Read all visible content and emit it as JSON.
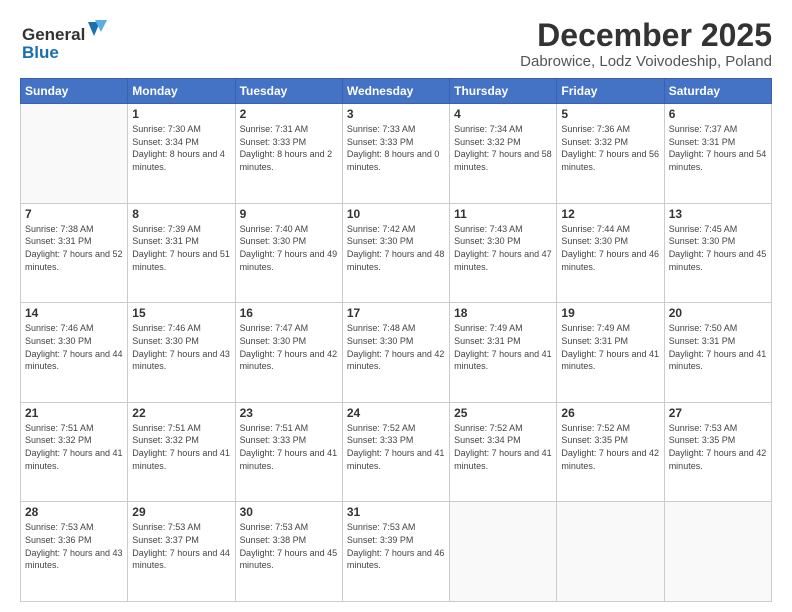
{
  "header": {
    "logo_line1": "General",
    "logo_line2": "Blue",
    "title": "December 2025",
    "subtitle": "Dabrowice, Lodz Voivodeship, Poland"
  },
  "weekdays": [
    "Sunday",
    "Monday",
    "Tuesday",
    "Wednesday",
    "Thursday",
    "Friday",
    "Saturday"
  ],
  "weeks": [
    [
      {
        "day": "",
        "sunrise": "",
        "sunset": "",
        "daylight": ""
      },
      {
        "day": "1",
        "sunrise": "7:30 AM",
        "sunset": "3:34 PM",
        "daylight": "8 hours and 4 minutes."
      },
      {
        "day": "2",
        "sunrise": "7:31 AM",
        "sunset": "3:33 PM",
        "daylight": "8 hours and 2 minutes."
      },
      {
        "day": "3",
        "sunrise": "7:33 AM",
        "sunset": "3:33 PM",
        "daylight": "8 hours and 0 minutes."
      },
      {
        "day": "4",
        "sunrise": "7:34 AM",
        "sunset": "3:32 PM",
        "daylight": "7 hours and 58 minutes."
      },
      {
        "day": "5",
        "sunrise": "7:36 AM",
        "sunset": "3:32 PM",
        "daylight": "7 hours and 56 minutes."
      },
      {
        "day": "6",
        "sunrise": "7:37 AM",
        "sunset": "3:31 PM",
        "daylight": "7 hours and 54 minutes."
      }
    ],
    [
      {
        "day": "7",
        "sunrise": "7:38 AM",
        "sunset": "3:31 PM",
        "daylight": "7 hours and 52 minutes."
      },
      {
        "day": "8",
        "sunrise": "7:39 AM",
        "sunset": "3:31 PM",
        "daylight": "7 hours and 51 minutes."
      },
      {
        "day": "9",
        "sunrise": "7:40 AM",
        "sunset": "3:30 PM",
        "daylight": "7 hours and 49 minutes."
      },
      {
        "day": "10",
        "sunrise": "7:42 AM",
        "sunset": "3:30 PM",
        "daylight": "7 hours and 48 minutes."
      },
      {
        "day": "11",
        "sunrise": "7:43 AM",
        "sunset": "3:30 PM",
        "daylight": "7 hours and 47 minutes."
      },
      {
        "day": "12",
        "sunrise": "7:44 AM",
        "sunset": "3:30 PM",
        "daylight": "7 hours and 46 minutes."
      },
      {
        "day": "13",
        "sunrise": "7:45 AM",
        "sunset": "3:30 PM",
        "daylight": "7 hours and 45 minutes."
      }
    ],
    [
      {
        "day": "14",
        "sunrise": "7:46 AM",
        "sunset": "3:30 PM",
        "daylight": "7 hours and 44 minutes."
      },
      {
        "day": "15",
        "sunrise": "7:46 AM",
        "sunset": "3:30 PM",
        "daylight": "7 hours and 43 minutes."
      },
      {
        "day": "16",
        "sunrise": "7:47 AM",
        "sunset": "3:30 PM",
        "daylight": "7 hours and 42 minutes."
      },
      {
        "day": "17",
        "sunrise": "7:48 AM",
        "sunset": "3:30 PM",
        "daylight": "7 hours and 42 minutes."
      },
      {
        "day": "18",
        "sunrise": "7:49 AM",
        "sunset": "3:31 PM",
        "daylight": "7 hours and 41 minutes."
      },
      {
        "day": "19",
        "sunrise": "7:49 AM",
        "sunset": "3:31 PM",
        "daylight": "7 hours and 41 minutes."
      },
      {
        "day": "20",
        "sunrise": "7:50 AM",
        "sunset": "3:31 PM",
        "daylight": "7 hours and 41 minutes."
      }
    ],
    [
      {
        "day": "21",
        "sunrise": "7:51 AM",
        "sunset": "3:32 PM",
        "daylight": "7 hours and 41 minutes."
      },
      {
        "day": "22",
        "sunrise": "7:51 AM",
        "sunset": "3:32 PM",
        "daylight": "7 hours and 41 minutes."
      },
      {
        "day": "23",
        "sunrise": "7:51 AM",
        "sunset": "3:33 PM",
        "daylight": "7 hours and 41 minutes."
      },
      {
        "day": "24",
        "sunrise": "7:52 AM",
        "sunset": "3:33 PM",
        "daylight": "7 hours and 41 minutes."
      },
      {
        "day": "25",
        "sunrise": "7:52 AM",
        "sunset": "3:34 PM",
        "daylight": "7 hours and 41 minutes."
      },
      {
        "day": "26",
        "sunrise": "7:52 AM",
        "sunset": "3:35 PM",
        "daylight": "7 hours and 42 minutes."
      },
      {
        "day": "27",
        "sunrise": "7:53 AM",
        "sunset": "3:35 PM",
        "daylight": "7 hours and 42 minutes."
      }
    ],
    [
      {
        "day": "28",
        "sunrise": "7:53 AM",
        "sunset": "3:36 PM",
        "daylight": "7 hours and 43 minutes."
      },
      {
        "day": "29",
        "sunrise": "7:53 AM",
        "sunset": "3:37 PM",
        "daylight": "7 hours and 44 minutes."
      },
      {
        "day": "30",
        "sunrise": "7:53 AM",
        "sunset": "3:38 PM",
        "daylight": "7 hours and 45 minutes."
      },
      {
        "day": "31",
        "sunrise": "7:53 AM",
        "sunset": "3:39 PM",
        "daylight": "7 hours and 46 minutes."
      },
      {
        "day": "",
        "sunrise": "",
        "sunset": "",
        "daylight": ""
      },
      {
        "day": "",
        "sunrise": "",
        "sunset": "",
        "daylight": ""
      },
      {
        "day": "",
        "sunrise": "",
        "sunset": "",
        "daylight": ""
      }
    ]
  ]
}
